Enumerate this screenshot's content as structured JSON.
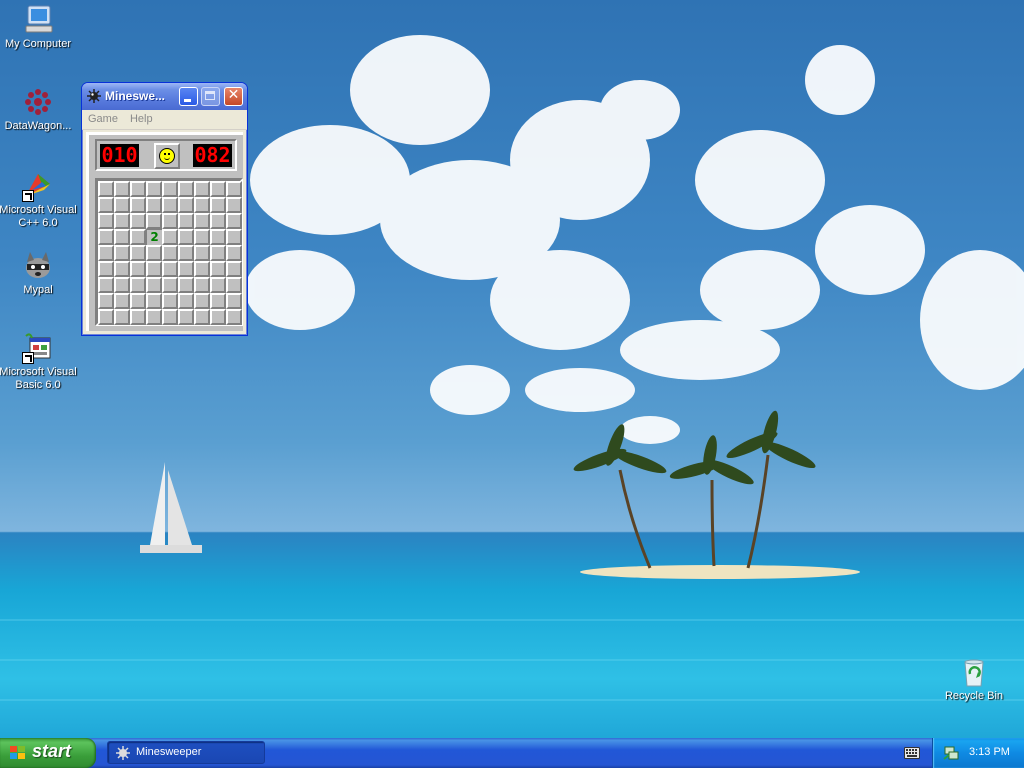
{
  "desktop": {
    "icons": [
      {
        "label": "My Computer"
      },
      {
        "label": "DataWagon..."
      },
      {
        "label": "Microsoft Visual C++ 6.0"
      },
      {
        "label": "Mypal"
      },
      {
        "label": "Microsoft Visual Basic 6.0"
      },
      {
        "label": "Recycle Bin"
      }
    ]
  },
  "minesweeper": {
    "title": "Mineswe...",
    "menu": [
      "Game",
      "Help"
    ],
    "mine_counter": "010",
    "timer": "082",
    "revealed_cell_value": "2",
    "grid_size": "9x9"
  },
  "taskbar": {
    "start_label": "start",
    "task_label": "Minesweeper",
    "clock": "3:13 PM"
  },
  "icons": {
    "title_close": "close-icon",
    "title_min": "minimize-icon",
    "title_max": "maximize-icon",
    "smiley": "smiley-face-icon"
  },
  "colors": {
    "led_digits": "#ff0000",
    "cell_number_2": "#008000",
    "title_bar": "#4a6bd2",
    "taskbar": "#2555d3",
    "start_button": "#3a9e3a"
  }
}
